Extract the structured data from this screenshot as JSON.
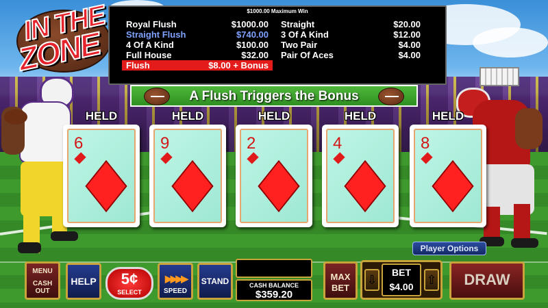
{
  "logo": {
    "line1": "IN THE",
    "line2": "ZONE"
  },
  "paytable": {
    "max_win": "$1000.00 Maximum Win",
    "left": [
      {
        "name": "Royal Flush",
        "value": "$1000.00"
      },
      {
        "name": "Straight Flush",
        "value": "$740.00"
      },
      {
        "name": "4 Of A Kind",
        "value": "$100.00"
      },
      {
        "name": "Full House",
        "value": "$32.00"
      },
      {
        "name": "Flush",
        "value": "$8.00 + Bonus"
      }
    ],
    "right": [
      {
        "name": "Straight",
        "value": "$20.00"
      },
      {
        "name": "3 Of A Kind",
        "value": "$12.00"
      },
      {
        "name": "Two Pair",
        "value": "$4.00"
      },
      {
        "name": "Pair Of Aces",
        "value": "$4.00"
      }
    ]
  },
  "banner": {
    "text": "A Flush Triggers the Bonus"
  },
  "hand": {
    "held_label": "HELD",
    "cards": [
      {
        "rank": "6",
        "suit": "diamond"
      },
      {
        "rank": "9",
        "suit": "diamond"
      },
      {
        "rank": "2",
        "suit": "diamond"
      },
      {
        "rank": "4",
        "suit": "diamond"
      },
      {
        "rank": "8",
        "suit": "diamond"
      }
    ]
  },
  "controls": {
    "menu_line1": "MENU",
    "menu_line2": "CASH",
    "menu_line3": "OUT",
    "help": "HELP",
    "denomination": "5¢",
    "denomination_select": "SELECT",
    "speed": "SPEED",
    "stand": "STAND",
    "cash_balance_label": "CASH BALANCE",
    "cash_balance_value": "$359.20",
    "max_bet_line1": "MAX",
    "max_bet_line2": "BET",
    "bet_label": "BET",
    "bet_value": "$4.00",
    "draw": "DRAW",
    "player_options": "Player Options"
  },
  "icons": {
    "bet_decrease": "arrow-down-icon",
    "bet_increase": "arrow-up-icon",
    "speed": "fast-forward-icon",
    "football": "football-icon"
  },
  "colors": {
    "card_suit": "#ff2020",
    "highlight_row": "#e31b1b",
    "highlight_text": "#7fa2ff",
    "button_trim": "#c9a43a"
  }
}
